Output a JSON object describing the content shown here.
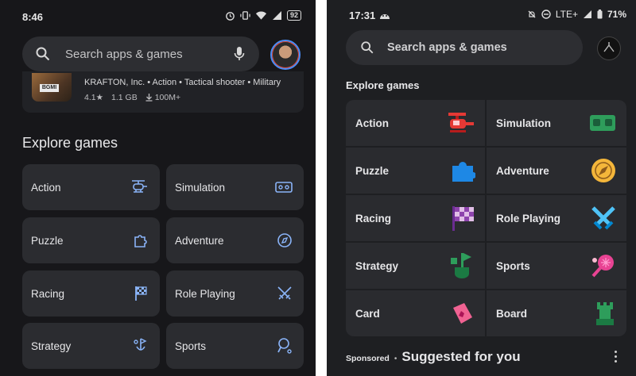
{
  "left": {
    "status": {
      "time": "8:46",
      "battery": "92"
    },
    "search": {
      "placeholder": "Search apps & games"
    },
    "app_card": {
      "developer_line": "KRAFTON, Inc. • Action • Tactical shooter • Military",
      "rating": "4.1★",
      "size": "1.1 GB",
      "downloads": "100M+",
      "icon_text": "BGMI"
    },
    "section_title": "Explore games",
    "categories": [
      {
        "label": "Action",
        "icon": "helicopter-outline-icon"
      },
      {
        "label": "Simulation",
        "icon": "vr-headset-outline-icon"
      },
      {
        "label": "Puzzle",
        "icon": "puzzle-outline-icon"
      },
      {
        "label": "Adventure",
        "icon": "compass-outline-icon"
      },
      {
        "label": "Racing",
        "icon": "checkered-flag-outline-icon"
      },
      {
        "label": "Role Playing",
        "icon": "crossed-swords-outline-icon"
      },
      {
        "label": "Strategy",
        "icon": "golf-flag-outline-icon"
      },
      {
        "label": "Sports",
        "icon": "racket-outline-icon"
      }
    ]
  },
  "right": {
    "status": {
      "time": "17:31",
      "network": "LTE+",
      "battery": "71%"
    },
    "search": {
      "placeholder": "Search apps & games"
    },
    "section_title": "Explore games",
    "categories": [
      {
        "label": "Action",
        "icon": "helicopter-icon",
        "color": "#e53935"
      },
      {
        "label": "Simulation",
        "icon": "vr-headset-icon",
        "color": "#2e9d5b"
      },
      {
        "label": "Puzzle",
        "icon": "puzzle-icon",
        "color": "#1e88e5"
      },
      {
        "label": "Adventure",
        "icon": "compass-icon",
        "color": "#f4b63a"
      },
      {
        "label": "Racing",
        "icon": "checkered-flag-icon",
        "color": "#8e44ad"
      },
      {
        "label": "Role Playing",
        "icon": "crossed-swords-icon",
        "color": "#4fc3f7"
      },
      {
        "label": "Strategy",
        "icon": "golf-flag-icon",
        "color": "#2e9d5b"
      },
      {
        "label": "Sports",
        "icon": "racket-icon",
        "color": "#e84393"
      },
      {
        "label": "Card",
        "icon": "card-icon",
        "color": "#f06292"
      },
      {
        "label": "Board",
        "icon": "chess-piece-icon",
        "color": "#2e9d5b"
      }
    ],
    "sponsored_label": "Sponsored",
    "suggested_title": "Suggested for you"
  }
}
